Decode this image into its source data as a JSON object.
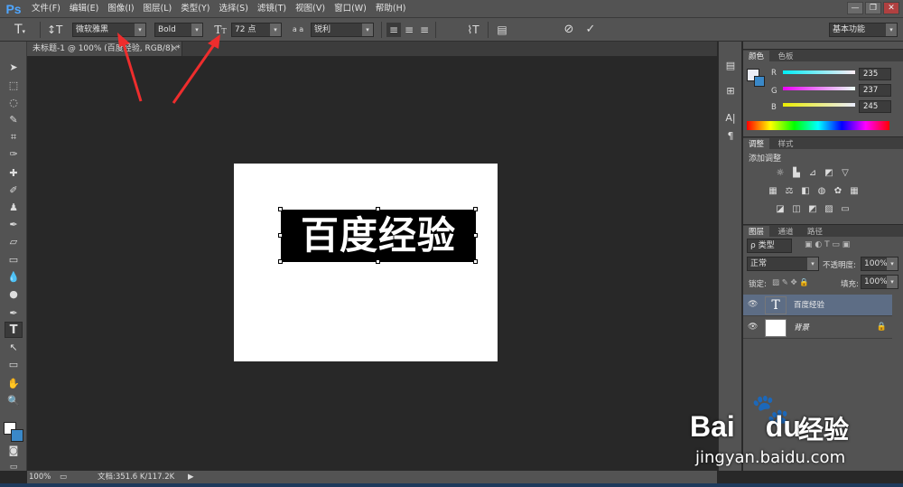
{
  "app": {
    "logo": "Ps"
  },
  "menu": [
    "文件(F)",
    "编辑(E)",
    "图像(I)",
    "图层(L)",
    "类型(Y)",
    "选择(S)",
    "滤镜(T)",
    "视图(V)",
    "窗口(W)",
    "帮助(H)"
  ],
  "window_buttons": [
    "—",
    "❐",
    "✕"
  ],
  "options": {
    "font_family": "微软雅黑",
    "font_style": "Bold",
    "font_size": "72 点",
    "aa_label": "a a",
    "antialias": "锐利",
    "workspace": "基本功能",
    "text_color": "#000000"
  },
  "document": {
    "tab_title": "未标题-1 @ 100% (百度经验, RGB/8) *",
    "tab_close": "×",
    "text": "百度经验"
  },
  "status": {
    "zoom": "100%",
    "doc_info": "文档:351.6 K/117.2K"
  },
  "panels": {
    "color_tabs": [
      "颜色",
      "色板"
    ],
    "rgb": [
      {
        "label": "R",
        "value": "235"
      },
      {
        "label": "G",
        "value": "237"
      },
      {
        "label": "B",
        "value": "245"
      }
    ],
    "adjust_tabs": [
      "调整",
      "样式"
    ],
    "adjust_title": "添加调整",
    "layer_tabs": [
      "图层",
      "通道",
      "路径"
    ],
    "layer_filter": "ρ 类型",
    "blend_mode": "正常",
    "opacity_label": "不透明度:",
    "opacity_value": "100%",
    "lock_label": "锁定:",
    "fill_label": "填充:",
    "fill_value": "100%",
    "layers": [
      {
        "name": "百度经验",
        "type": "text",
        "selected": true
      },
      {
        "name": "背景",
        "type": "background",
        "selected": false
      }
    ]
  },
  "watermark": {
    "brand": "Bai",
    "brand2": "du",
    "cn": "经验",
    "url": "jingyan.baidu.com"
  },
  "colors": {
    "accent": "#4fa6ff",
    "panel_bg": "#535353",
    "canvas_bg": "#282828",
    "selected_layer": "#5d6d85"
  }
}
